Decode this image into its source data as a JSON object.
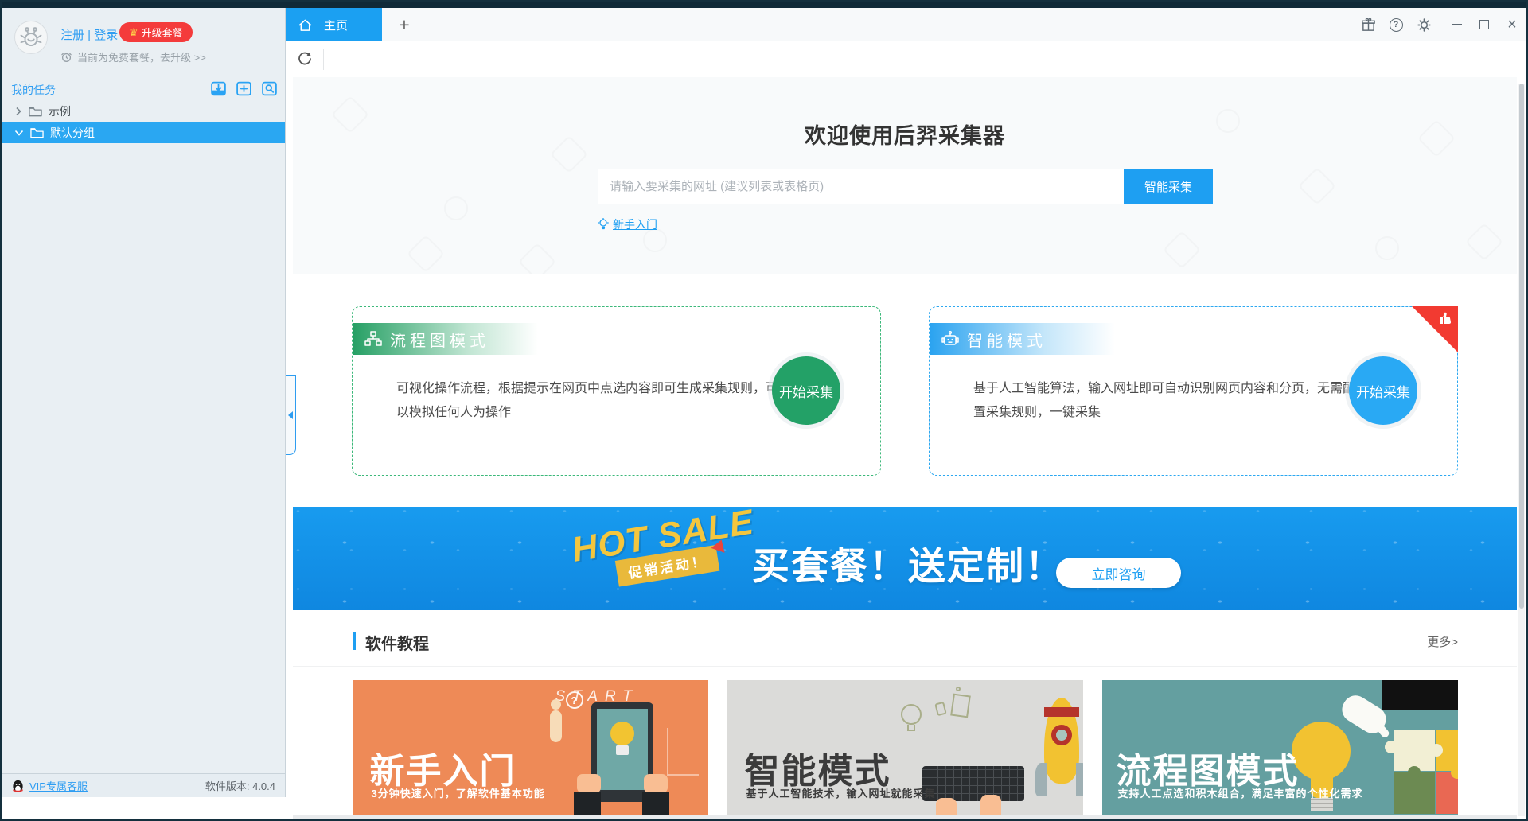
{
  "colors": {
    "accent_blue": "#1e9ff2",
    "tab_blue": "#1ba0f2",
    "selected_row_blue": "#2aa7f2",
    "upgrade_red": "#f43b3b",
    "flow_green": "#23a167",
    "smart_blue": "#29a9f4",
    "banner_blue": "#1390e9",
    "card_orange": "#ee8a57",
    "card_gray": "#dbdbd9",
    "card_teal": "#649fa0"
  },
  "sidebar": {
    "register_login": "注册 | 登录",
    "upgrade_crown": "♛",
    "upgrade_badge": "升级套餐",
    "plan_notice": "当前为免费套餐，去升级 >>",
    "tasks_header": "我的任务",
    "tree": [
      {
        "label": "示例",
        "expanded": false,
        "selected": false
      },
      {
        "label": "默认分组",
        "expanded": true,
        "selected": true
      }
    ],
    "footer_support": "VIP专属客服",
    "footer_version": "软件版本: 4.0.4"
  },
  "tabbar": {
    "home_tab": "主页",
    "new_tab": "+"
  },
  "window_controls": {
    "help_glyph": "?",
    "close_glyph": "×"
  },
  "hero": {
    "title": "欢迎使用后羿采集器",
    "url_placeholder": "请输入要采集的网址 (建议列表或表格页)",
    "smart_button": "智能采集",
    "beginner_link": "新手入门"
  },
  "modes": [
    {
      "name": "流程图模式",
      "description": "可视化操作流程，根据提示在网页中点选内容即可生成采集规则，可以模拟任何人为操作",
      "action": "开始采集"
    },
    {
      "name": "智能模式",
      "description": "基于人工智能算法，输入网址即可自动识别网页内容和分页，无需配置采集规则，一键采集",
      "action": "开始采集"
    }
  ],
  "banner": {
    "hot_sale": "HOT SALE",
    "ribbon": "促销活动！",
    "headline": "买套餐！送定制！",
    "cta": "立即咨询"
  },
  "tutorials": {
    "section_title": "软件教程",
    "more_link": "更多>",
    "cards": [
      {
        "title": "新手入门",
        "subtitle": "3分钟快速入门，了解软件基本功能",
        "sketch": "START"
      },
      {
        "title": "智能模式",
        "subtitle": "基于人工智能技术，输入网址就能采集",
        "sketch": ""
      },
      {
        "title": "流程图模式",
        "subtitle": "支持人工点选和积木组合，满足丰富的个性化需求",
        "sketch": ""
      }
    ]
  }
}
